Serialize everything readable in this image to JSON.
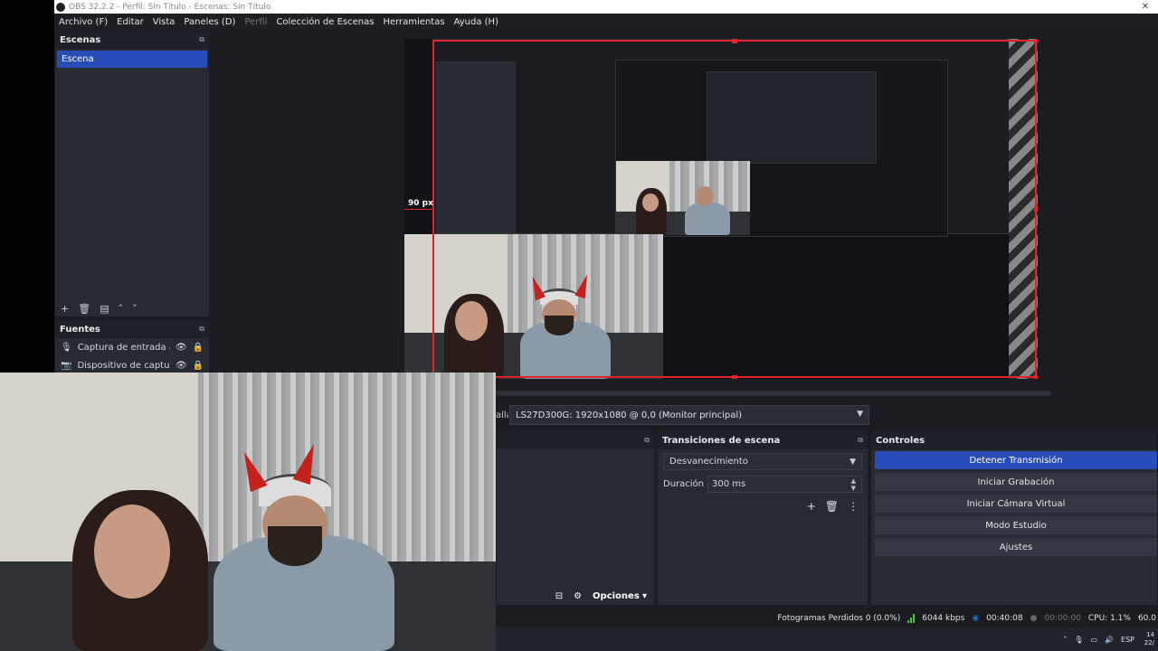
{
  "window": {
    "title": "OBS 32.2.2 - Perfil: Sin Título - Escenas: Sin Título"
  },
  "menu": [
    {
      "label": "Archivo (F)",
      "enabled": true
    },
    {
      "label": "Editar",
      "enabled": true
    },
    {
      "label": "Vista",
      "enabled": true
    },
    {
      "label": "Paneles (D)",
      "enabled": true
    },
    {
      "label": "Perfil",
      "enabled": false
    },
    {
      "label": "Colección de Escenas",
      "enabled": true
    },
    {
      "label": "Herramientas",
      "enabled": true
    },
    {
      "label": "Ayuda (H)",
      "enabled": true
    }
  ],
  "scenes": {
    "title": "Escenas",
    "items": [
      "Escena"
    ],
    "selected": "Escena"
  },
  "sources": {
    "title": "Fuentes",
    "items": [
      {
        "label": "Captura de entrada audio",
        "icon": "microphone-icon"
      },
      {
        "label": "Dispositivo de captura de vi",
        "icon": "camera-icon"
      }
    ]
  },
  "preview": {
    "crop_label": "90 px"
  },
  "display": {
    "label_fragment": "alla",
    "monitor": "LS27D300G: 1920x1080 @ 0,0 (Monitor principal)"
  },
  "mixer": {
    "options_label": "Opciones"
  },
  "transitions": {
    "title": "Transiciones de escena",
    "selected": "Desvanecimiento",
    "duration_label": "Duración",
    "duration_value": "300 ms"
  },
  "controls": {
    "title": "Controles",
    "buttons": [
      "Detener Transmisión",
      "Iniciar Grabación",
      "Iniciar Cámara Virtual",
      "Modo Estudio",
      "Ajustes"
    ]
  },
  "status": {
    "dropped_frames": "Fotogramas Perdidos 0 (0.0%)",
    "bitrate": "6044 kbps",
    "stream_time": "00:40:08",
    "record_time": "00:00:00",
    "cpu": "CPU: 1.1%",
    "fps": "60.0",
    "colors": {
      "bitrate": "#4fbf45",
      "live": "#1e6fd0"
    }
  },
  "taskbar": {
    "language": "ESP",
    "clock_top": "14",
    "clock_bottom": "22/"
  }
}
